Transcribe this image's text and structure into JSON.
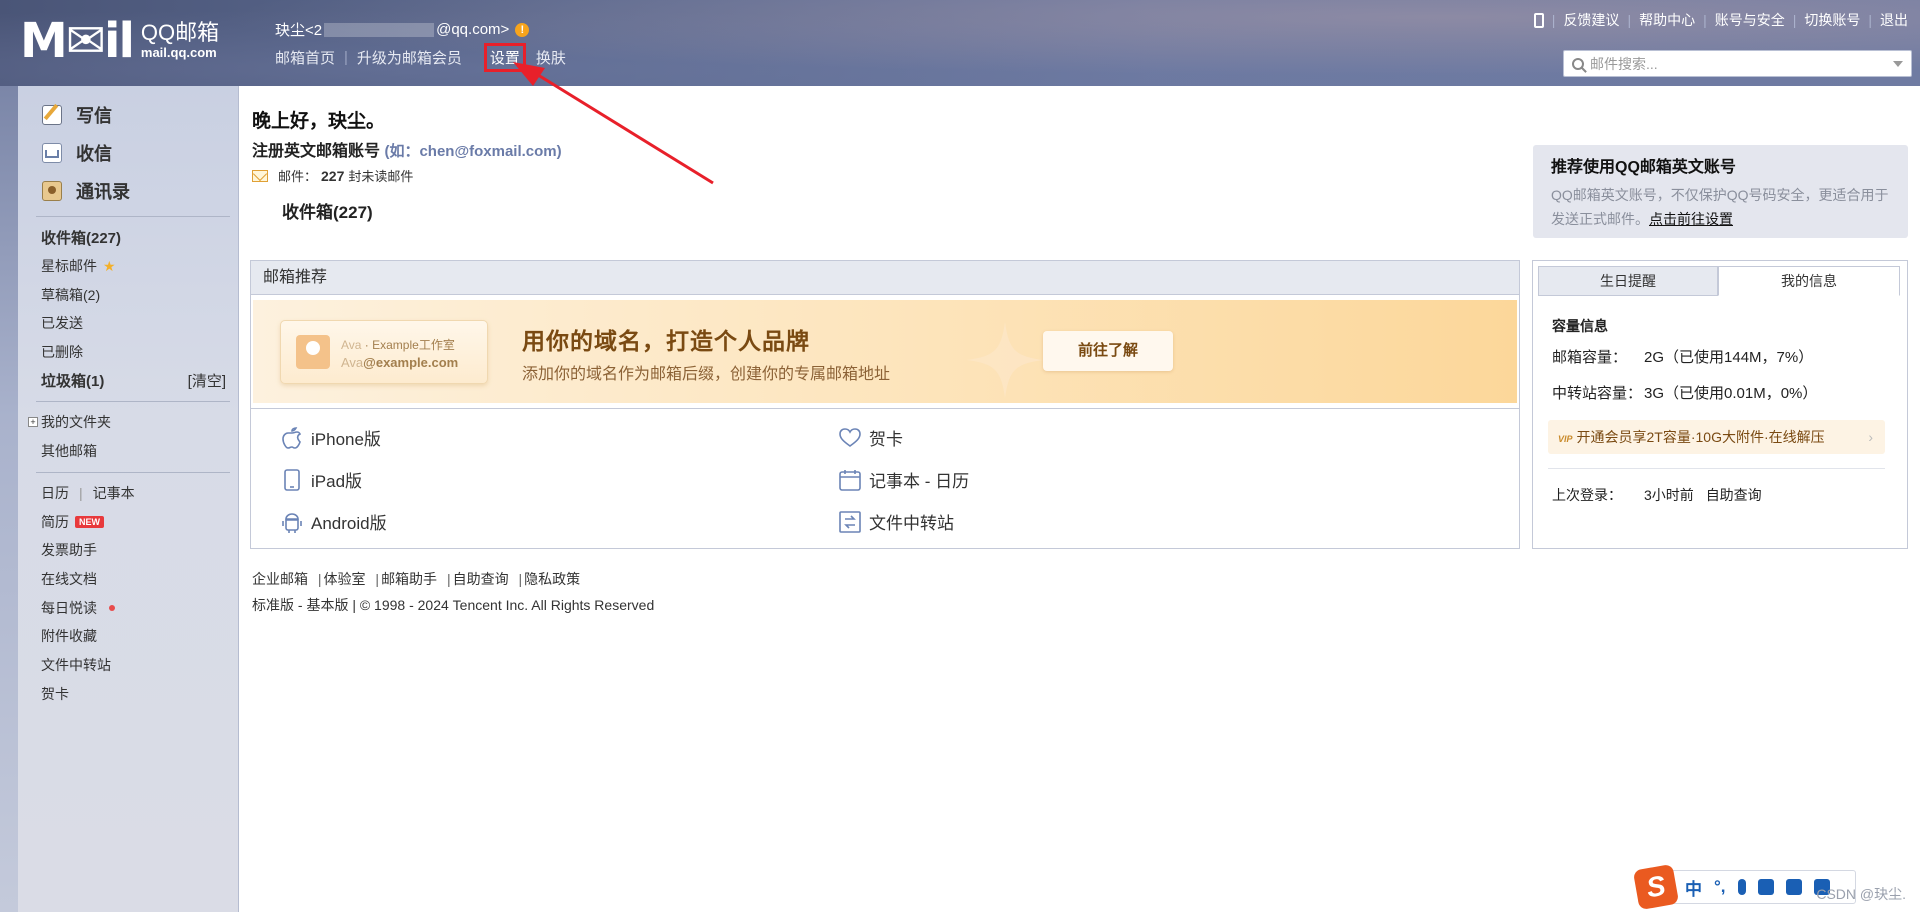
{
  "header": {
    "logo_mark": "M✉il",
    "logo_name": "QQ邮箱",
    "logo_domain": "mail.qq.com",
    "account_prefix": "玦尘<2",
    "account_suffix": "@qq.com>",
    "warn_glyph": "!",
    "nav": [
      "邮箱首页",
      "升级为邮箱会员",
      "设置",
      "换肤"
    ],
    "highlighted_nav": "设置",
    "right_links": [
      "反馈建议",
      "帮助中心",
      "账号与安全",
      "切换账号",
      "退出"
    ],
    "search_placeholder": "邮件搜索..."
  },
  "sidebar": {
    "main_actions": [
      "写信",
      "收信",
      "通讯录"
    ],
    "folders": [
      {
        "label": "收件箱(227)",
        "bold": true
      },
      {
        "label": "星标邮件",
        "star": "★"
      },
      {
        "label": "草稿箱(2)"
      },
      {
        "label": "已发送"
      },
      {
        "label": "已删除"
      },
      {
        "label": "垃圾箱(1)",
        "bold": true,
        "action": "[清空]"
      }
    ],
    "my_folders": "我的文件夹",
    "other_mail": "其他邮箱",
    "tools": {
      "calendar": "日历",
      "notebook": "记事本",
      "resume": "简历",
      "new_badge": "NEW",
      "invoice": "发票助手",
      "docs": "在线文档",
      "daily": "每日悦读",
      "attachments": "附件收藏",
      "transfer": "文件中转站",
      "cards": "贺卡"
    }
  },
  "main": {
    "greeting": "晚上好，玦尘。",
    "register_title": "注册英文邮箱账号",
    "register_example": "(如：chen@foxmail.com)",
    "mail_label": "邮件：",
    "mail_count": "227",
    "mail_unread": "封未读邮件",
    "inbox_label": "收件箱(227)",
    "rec_title": "邮箱推荐",
    "banner": {
      "card_name": "Ava",
      "card_studio": " · Example工作室",
      "card_user": "Ava",
      "card_domain": "@example.com",
      "title": "用你的域名，打造个人品牌",
      "subtitle": "添加你的域名作为邮箱后缀，创建你的专属邮箱地址",
      "button": "前往了解"
    },
    "apps": {
      "iphone": "iPhone版",
      "ipad": "iPad版",
      "android": "Android版",
      "card": "贺卡",
      "notebook_calendar": "记事本 - 日历",
      "transfer": "文件中转站"
    },
    "footer_links": [
      "企业邮箱",
      "体验室",
      "邮箱助手",
      "自助查询",
      "隐私政策"
    ],
    "footer_copy": "标准版 - 基本版 | © 1998 - 2024 Tencent Inc. All Rights Reserved"
  },
  "right": {
    "promo_title": "推荐使用QQ邮箱英文账号",
    "promo_desc": "QQ邮箱英文账号，不仅保护QQ号码安全，更适合用于发送正式邮件。",
    "promo_link": "点击前往设置",
    "tabs": [
      "生日提醒",
      "我的信息"
    ],
    "capacity_title": "容量信息",
    "mail_cap_label": "邮箱容量：",
    "mail_cap_value": "2G（已使用144M，7%）",
    "transfer_cap_label": "中转站容量：",
    "transfer_cap_value": "3G（已使用0.01M，0%）",
    "vip_mark": "VIP",
    "vip_text": "开通会员享2T容量·10G大附件·在线解压",
    "last_login_label": "上次登录：",
    "last_login_value": "3小时前",
    "self_query": "自助查询"
  },
  "ime": {
    "logo": "S",
    "lang": "中",
    "punct": "°,"
  },
  "watermark": "CSDN @玦尘."
}
